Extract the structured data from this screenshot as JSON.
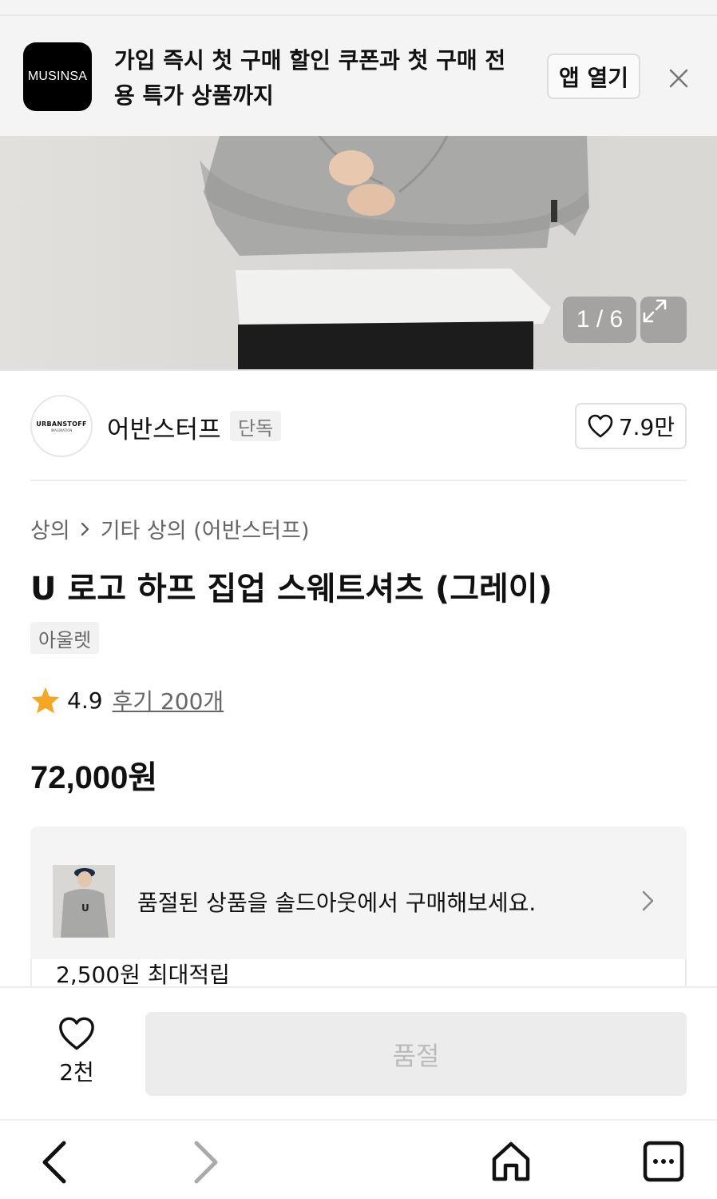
{
  "banner": {
    "logo_text": "MUSINSA",
    "message": "가입 즉시 첫 구매 할인 쿠폰과 첫 구매 전용 특가 상품까지",
    "open_app_label": "앱 열기"
  },
  "gallery": {
    "counter": "1 / 6"
  },
  "brand": {
    "logo_text": "URBANSTOFF",
    "logo_subtext": "IMAGINATION",
    "name": "어반스터프",
    "tag": "단독",
    "likes": "7.9만"
  },
  "product": {
    "breadcrumb": [
      "상의",
      "기타 상의 (어반스터프)"
    ],
    "title": "U 로고 하프 집업 스웨트셔츠 (그레이)",
    "tag": "아울렛",
    "rating": "4.9",
    "review_link": "후기 200개",
    "price": "72,000원"
  },
  "soldout": {
    "message": "품절된 상품을 솔드아웃에서 구매해보세요.",
    "points": "2,500원 최대적립"
  },
  "action_bar": {
    "wish_count": "2천",
    "buy_label": "품절"
  },
  "colors": {
    "star": "#f5a623",
    "logo_bg": "#000000",
    "disabled_btn": "#ececec"
  }
}
